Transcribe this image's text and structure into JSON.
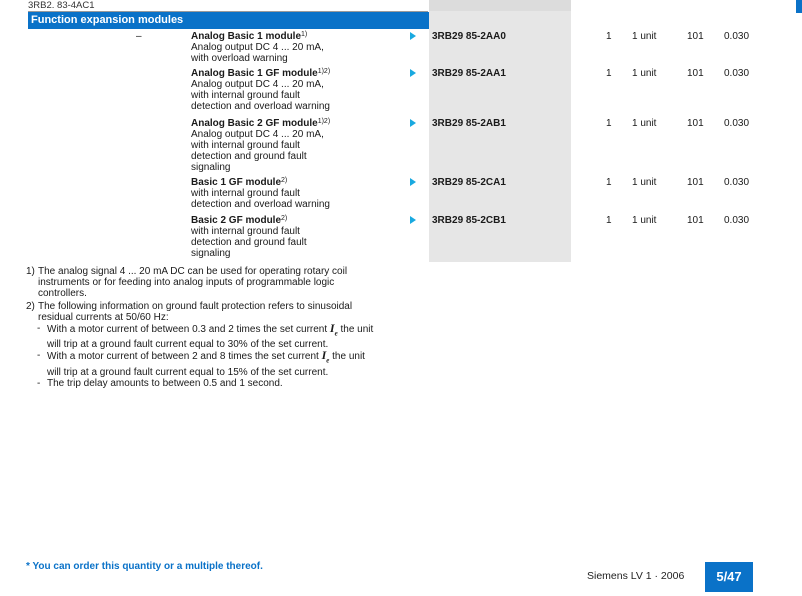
{
  "header": {
    "topline": "3RB2. 83-4AC1",
    "section_title": "Function expansion modules"
  },
  "rows": [
    {
      "dash": "–",
      "title": "Analog Basic 1 module",
      "sup": "1)",
      "lines": [
        "Analog output DC 4 ... 20 mA,",
        "with overload warning"
      ],
      "order_no": "3RB29 85-2AA0",
      "qty": "1",
      "unit": "1 unit",
      "pg": "101",
      "weight": "0.030"
    },
    {
      "dash": "",
      "title": "Analog Basic 1 GF module",
      "sup": "1)2)",
      "lines": [
        "Analog output DC 4 ... 20 mA,",
        "with internal ground fault",
        "detection and overload warning"
      ],
      "order_no": "3RB29 85-2AA1",
      "qty": "1",
      "unit": "1 unit",
      "pg": "101",
      "weight": "0.030"
    },
    {
      "dash": "",
      "title": "Analog Basic 2 GF module",
      "sup": "1)2)",
      "lines": [
        "Analog output DC 4 ... 20 mA,",
        "with internal ground fault",
        "detection and ground fault",
        "signaling"
      ],
      "order_no": "3RB29 85-2AB1",
      "qty": "1",
      "unit": "1 unit",
      "pg": "101",
      "weight": "0.030"
    },
    {
      "dash": "",
      "title": "Basic 1 GF module",
      "sup": "2)",
      "lines": [
        "with internal ground fault",
        "detection and overload warning"
      ],
      "order_no": "3RB29 85-2CA1",
      "qty": "1",
      "unit": "1 unit",
      "pg": "101",
      "weight": "0.030"
    },
    {
      "dash": "",
      "title": "Basic 2 GF module",
      "sup": "2)",
      "lines": [
        "with internal ground fault",
        "detection and ground fault",
        "signaling"
      ],
      "order_no": "3RB29 85-2CB1",
      "qty": "1",
      "unit": "1 unit",
      "pg": "101",
      "weight": "0.030"
    }
  ],
  "notes": {
    "n1_num": "1)",
    "n1_lines": [
      "The analog signal 4 ... 20 mA DC can be used for operating rotary coil",
      "instruments or for feeding into analog inputs of programmable logic",
      "controllers."
    ],
    "n2_num": "2)",
    "n2_lines": [
      "The following information on ground fault protection refers to sinusoidal",
      "residual currents at 50/60 Hz:"
    ],
    "bullet": "-",
    "b1_a": "With a motor current of between 0.3 and 2 times the set current ",
    "b1_b": " the unit",
    "b1_c": "will trip at a ground fault current equal to 30% of the set current.",
    "b2_a": "With a motor current of between 2 and 8 times the set current ",
    "b2_b": " the unit",
    "b2_c": "will trip at a ground fault current equal to 15% of the set current.",
    "b3": "The trip delay amounts to between 0.5 and 1 second.",
    "ie_symbol": "I",
    "ie_sub": "e"
  },
  "footer": {
    "footnote": "* You can order this quantity or a multiple thereof.",
    "catalog": "Siemens LV 1 · 2006",
    "page": "5/47"
  },
  "colors": {
    "brand_blue": "#0a72c8",
    "arrow_cyan": "#19a9e0",
    "column_gray": "#e6e6e6"
  }
}
